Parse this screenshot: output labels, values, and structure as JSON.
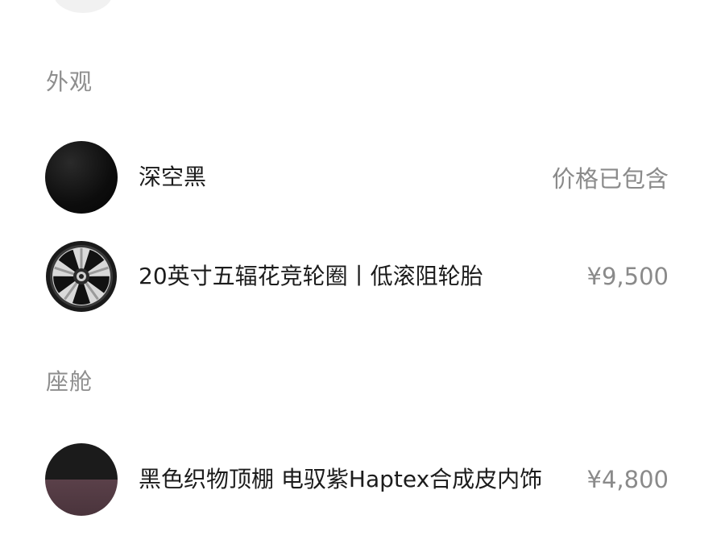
{
  "sections": {
    "exterior": {
      "title": "外观",
      "items": [
        {
          "label": "深空黑",
          "price": "价格已包含",
          "swatch": "deep-space-black"
        },
        {
          "label": "20英寸五辐花竞轮圈丨低滚阻轮胎",
          "price": "¥9,500",
          "swatch": "wheel"
        }
      ]
    },
    "cabin": {
      "title": "座舱",
      "items": [
        {
          "label": "黑色织物顶棚 电驭紫Haptex合成皮内饰",
          "price": "¥4,800",
          "swatch": "black-purple-interior"
        }
      ]
    }
  },
  "colors": {
    "section_title": "#8e8e8e",
    "price": "#8a8a8a",
    "label": "#1c1c1c",
    "interior_purple": "#5a4049"
  }
}
